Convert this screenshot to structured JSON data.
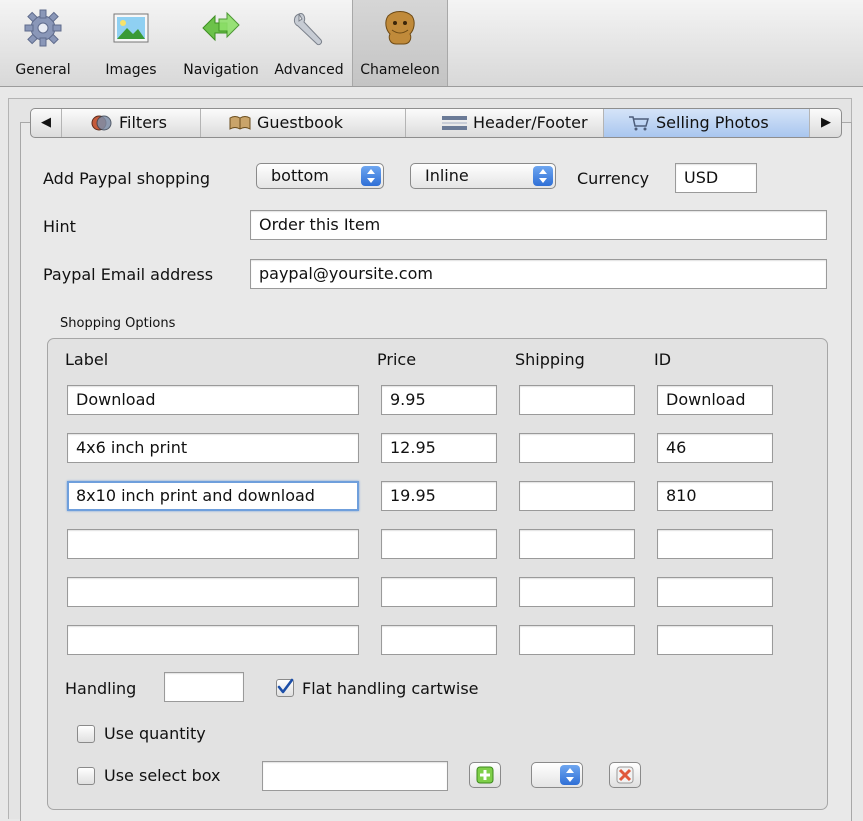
{
  "toolbar": {
    "items": [
      {
        "label": "General",
        "icon": "gear-icon"
      },
      {
        "label": "Images",
        "icon": "picture-icon"
      },
      {
        "label": "Navigation",
        "icon": "arrows-icon"
      },
      {
        "label": "Advanced",
        "icon": "wrench-icon"
      },
      {
        "label": "Chameleon",
        "icon": "chameleon-icon"
      }
    ],
    "selected": "Chameleon"
  },
  "tabs": {
    "items": [
      {
        "label": "Filters",
        "icon": "filters-icon"
      },
      {
        "label": "Guestbook",
        "icon": "book-icon"
      },
      {
        "label": "Header/Footer",
        "icon": "header-footer-icon"
      },
      {
        "label": "Selling Photos",
        "icon": "cart-icon"
      }
    ],
    "selected": "Selling Photos"
  },
  "form": {
    "paypal_label": "Add Paypal shopping",
    "position_value": "bottom",
    "style_value": "Inline",
    "currency_label": "Currency",
    "currency_value": "USD",
    "hint_label": "Hint",
    "hint_value": "Order this Item",
    "email_label": "Paypal Email address",
    "email_value": "paypal@yoursite.com"
  },
  "shopping": {
    "group_label": "Shopping Options",
    "headers": {
      "label": "Label",
      "price": "Price",
      "shipping": "Shipping",
      "id": "ID"
    },
    "rows": [
      {
        "label": "Download",
        "price": "9.95",
        "shipping": "",
        "id": "Download"
      },
      {
        "label": "4x6 inch print",
        "price": "12.95",
        "shipping": "",
        "id": "46"
      },
      {
        "label": "8x10 inch print and download",
        "price": "19.95",
        "shipping": "",
        "id": "810"
      },
      {
        "label": "",
        "price": "",
        "shipping": "",
        "id": ""
      },
      {
        "label": "",
        "price": "",
        "shipping": "",
        "id": ""
      },
      {
        "label": "",
        "price": "",
        "shipping": "",
        "id": ""
      }
    ],
    "handling_label": "Handling",
    "handling_value": "",
    "flat_handling_label": "Flat handling cartwise",
    "flat_handling_checked": true,
    "use_quantity_label": "Use quantity",
    "use_quantity_checked": false,
    "use_select_label": "Use select box",
    "use_select_checked": false,
    "select_value": ""
  },
  "colors": {
    "accent": "#3b7ee0",
    "focus_ring": "#6f9fdc",
    "selected_tab": "#bcd3f4"
  }
}
